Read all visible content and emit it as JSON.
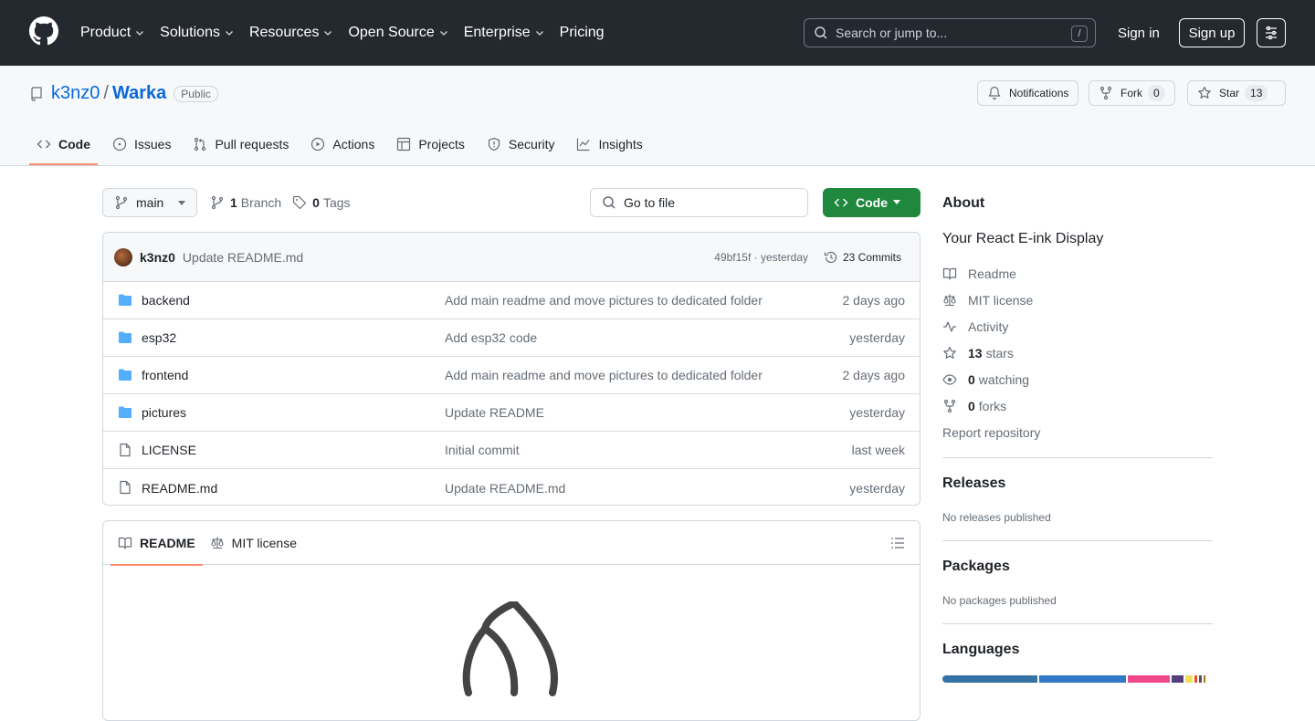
{
  "nav": {
    "items": [
      "Product",
      "Solutions",
      "Resources",
      "Open Source",
      "Enterprise",
      "Pricing"
    ],
    "search_placeholder": "Search or jump to...",
    "search_shortcut": "/",
    "sign_in": "Sign in",
    "sign_up": "Sign up"
  },
  "repo": {
    "owner": "k3nz0",
    "separator": "/",
    "name": "Warka",
    "visibility": "Public",
    "notifications_label": "Notifications",
    "fork_label": "Fork",
    "fork_count": "0",
    "star_label": "Star",
    "star_count": "13"
  },
  "tabs": [
    {
      "label": "Code",
      "icon": "code-icon"
    },
    {
      "label": "Issues",
      "icon": "issue-icon"
    },
    {
      "label": "Pull requests",
      "icon": "pull-request-icon"
    },
    {
      "label": "Actions",
      "icon": "play-icon"
    },
    {
      "label": "Projects",
      "icon": "table-icon"
    },
    {
      "label": "Security",
      "icon": "shield-icon"
    },
    {
      "label": "Insights",
      "icon": "graph-icon"
    }
  ],
  "browser": {
    "branch": "main",
    "branch_count": "1",
    "branch_label": "Branch",
    "tag_count": "0",
    "tag_label": "Tags",
    "goto_placeholder": "Go to file",
    "code_button": "Code"
  },
  "latest_commit": {
    "author": "k3nz0",
    "message": "Update README.md",
    "meta": "49bf15f · yesterday",
    "commits": "23 Commits"
  },
  "files": [
    {
      "type": "dir",
      "name": "backend",
      "message": "Add main readme and move pictures to dedicated folder",
      "date": "2 days ago"
    },
    {
      "type": "dir",
      "name": "esp32",
      "message": "Add esp32 code",
      "date": "yesterday"
    },
    {
      "type": "dir",
      "name": "frontend",
      "message": "Add main readme and move pictures to dedicated folder",
      "date": "2 days ago"
    },
    {
      "type": "dir",
      "name": "pictures",
      "message": "Update README",
      "date": "yesterday"
    },
    {
      "type": "file",
      "name": "LICENSE",
      "message": "Initial commit",
      "date": "last week"
    },
    {
      "type": "file",
      "name": "README.md",
      "message": "Update README.md",
      "date": "yesterday"
    }
  ],
  "readme": {
    "tab_readme": "README",
    "tab_license": "MIT license"
  },
  "about": {
    "title": "About",
    "description": "Your React E-ink Display",
    "readme": "Readme",
    "license": "MIT license",
    "activity": "Activity",
    "stars_count": "13",
    "stars_label": "stars",
    "watching_count": "0",
    "watching_label": "watching",
    "forks_count": "0",
    "forks_label": "forks",
    "report": "Report repository"
  },
  "releases": {
    "title": "Releases",
    "empty": "No releases published"
  },
  "packages": {
    "title": "Packages",
    "empty": "No packages published"
  },
  "languages": {
    "title": "Languages",
    "bar": [
      {
        "share": 0.37,
        "color": "#3572A5"
      },
      {
        "share": 0.336,
        "color": "#3178c6"
      },
      {
        "share": 0.163,
        "color": "#f1478d"
      },
      {
        "share": 0.045,
        "color": "#563d7c"
      },
      {
        "share": 0.03,
        "color": "#f1e05a"
      },
      {
        "share": 0.012,
        "color": "#e34c26"
      },
      {
        "share": 0.012,
        "color": "#555555"
      },
      {
        "share": 0.008,
        "color": "#b07219"
      }
    ]
  },
  "colors": {
    "header_bg": "#24292f",
    "link": "#0969da",
    "primary_button": "#1f883d",
    "active_tab_underline": "#fd8c73",
    "folder": "#54aeff"
  }
}
